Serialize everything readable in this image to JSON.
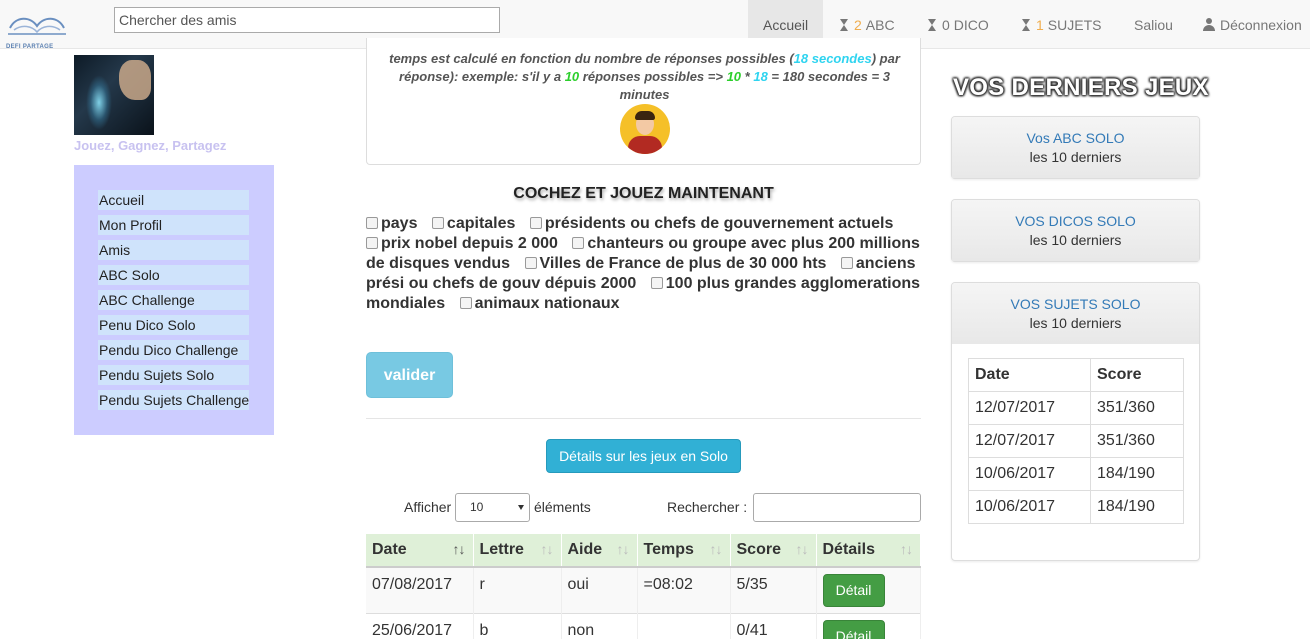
{
  "brand": {
    "text": "DEFI PARTAGE"
  },
  "search": {
    "placeholder": "Chercher des amis"
  },
  "nav": {
    "accueil": "Accueil",
    "abc": {
      "count": "2",
      "label": "ABC"
    },
    "dico": {
      "count": "0",
      "label": "DICO"
    },
    "sujets": {
      "count": "1",
      "label": "SUJETS"
    },
    "user": "Saliou",
    "logout": "Déconnexion"
  },
  "tagline": "Jouez, Gagnez, Partagez",
  "sidebar": {
    "items": [
      "Accueil",
      "Mon Profil",
      "Amis",
      "ABC Solo",
      "ABC Challenge",
      "Penu Dico Solo",
      "Pendu Dico Challenge",
      "Pendu Sujets Solo",
      "Pendu Sujets Challenge"
    ]
  },
  "info": {
    "t1": "temps est calculé en fonction du nombre de réponses possibles (",
    "seconds": "18 secondes",
    "t2": " par réponse): exemple: s'il y a ",
    "n1": "10",
    "t3": " réponses possibles => ",
    "n2": "10",
    "t4": " * ",
    "n3": "18",
    "t5": " = 180 secondes = 3 minutes"
  },
  "section_title": "COCHEZ ET JOUEZ MAINTENANT",
  "categories": [
    "pays",
    "capitales",
    "présidents ou chefs de gouvernement actuels",
    "prix nobel depuis 2 000",
    "chanteurs ou groupe avec plus 200 millions de disques vendus",
    "Villes de France de plus de 30 000 hts",
    "anciens prési ou chefs de gouv dépuis 2000",
    "100 plus grandes agglomerations mondiales",
    "animaux nationaux"
  ],
  "buttons": {
    "valider": "valider",
    "details_solo": "Détails sur les jeux en Solo"
  },
  "table_controls": {
    "show": "Afficher",
    "show_value": "10",
    "elements": "éléments",
    "search": "Rechercher :"
  },
  "games_table": {
    "headers": [
      "Date",
      "Lettre",
      "Aide",
      "Temps",
      "Score",
      "Détails"
    ],
    "rows": [
      {
        "date": "07/08/2017",
        "lettre": "r",
        "aide": "oui",
        "temps": "=08:02",
        "score": "5/35",
        "detail": "Détail"
      },
      {
        "date": "25/06/2017",
        "lettre": "b",
        "aide": "non",
        "temps": "",
        "score": "0/41",
        "detail": "Détail"
      }
    ]
  },
  "recent": {
    "title": "VOS DERNIERS JEUX",
    "panels": [
      {
        "link": "Vos ABC SOLO",
        "sub": "les 10 derniers"
      },
      {
        "link": "VOS DICOS SOLO",
        "sub": "les 10 derniers"
      },
      {
        "link": "VOS SUJETS SOLO",
        "sub": "les 10 derniers"
      }
    ],
    "score_table": {
      "headers": [
        "Date",
        "Score"
      ],
      "rows": [
        [
          "12/07/2017",
          "351/360"
        ],
        [
          "12/07/2017",
          "351/360"
        ],
        [
          "10/06/2017",
          "184/190"
        ],
        [
          "10/06/2017",
          "184/190"
        ]
      ]
    }
  }
}
